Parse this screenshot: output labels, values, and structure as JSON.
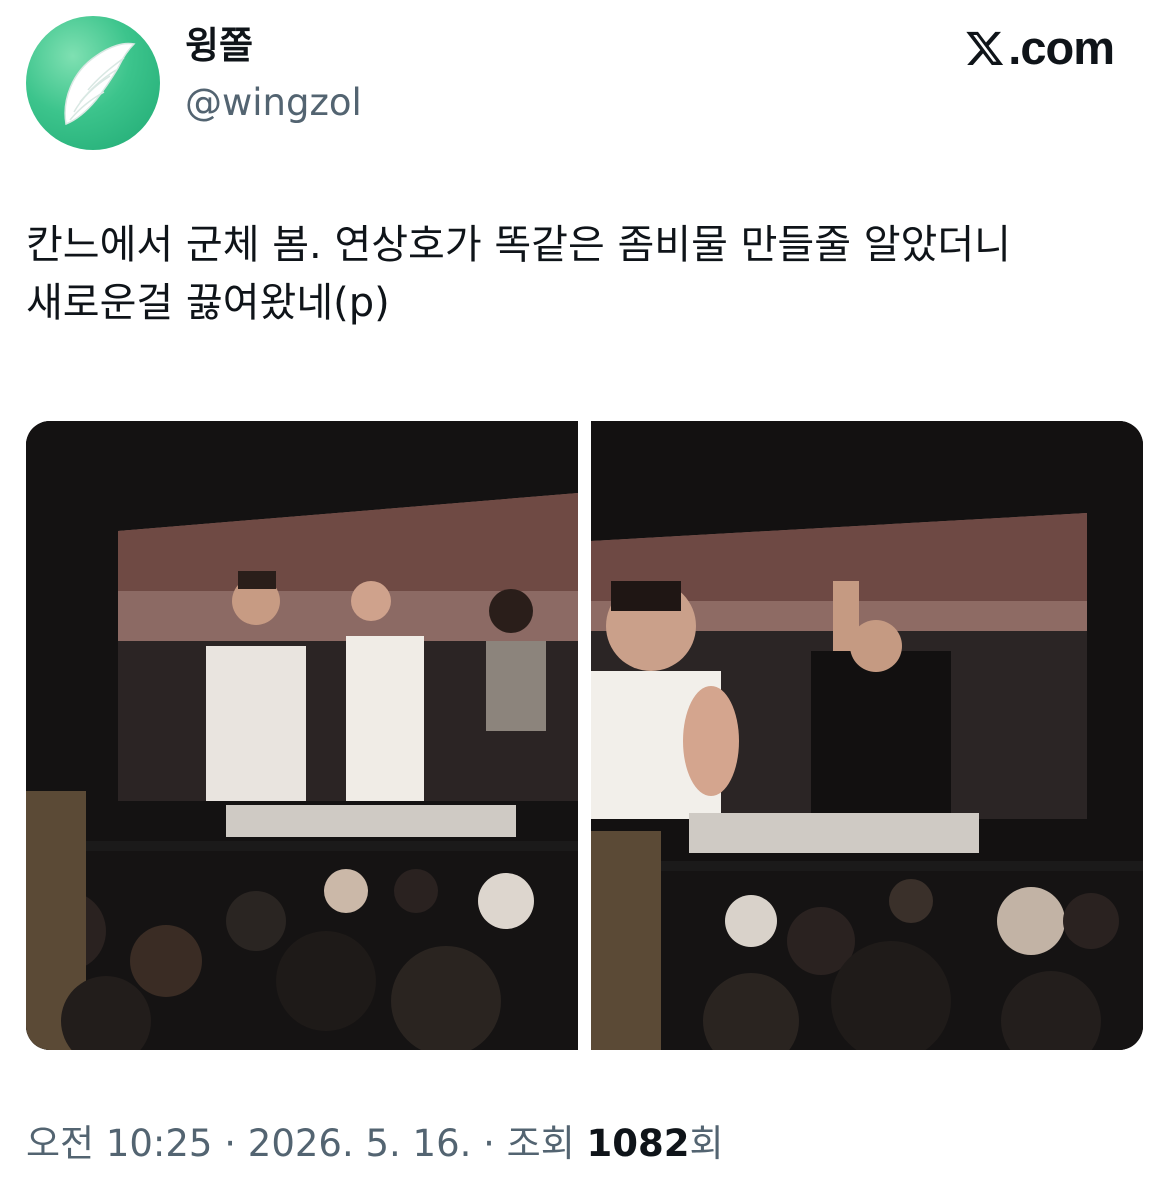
{
  "author": {
    "display_name": "윙쫄",
    "handle": "@wingzol",
    "avatar_icon": "angel-wing-icon",
    "avatar_color": "#3cc48c"
  },
  "brand": {
    "icon": "x-logo-icon",
    "label": ".com"
  },
  "tweet": {
    "text": "칸느에서 군체 봄. 연상호가 똑같은 좀비물 만들줄 알았더니 새로운걸 끓여왔네(p)"
  },
  "media": {
    "count": 2,
    "photo_icons": [
      "photo-icon",
      "photo-icon"
    ]
  },
  "footer": {
    "time": "오전 10:25",
    "separator": "·",
    "date": "2026. 5. 16.",
    "views_label": "조회",
    "views_count": "1082",
    "views_suffix": "회"
  },
  "colors": {
    "text_primary": "#0f1419",
    "text_secondary": "#536471"
  }
}
